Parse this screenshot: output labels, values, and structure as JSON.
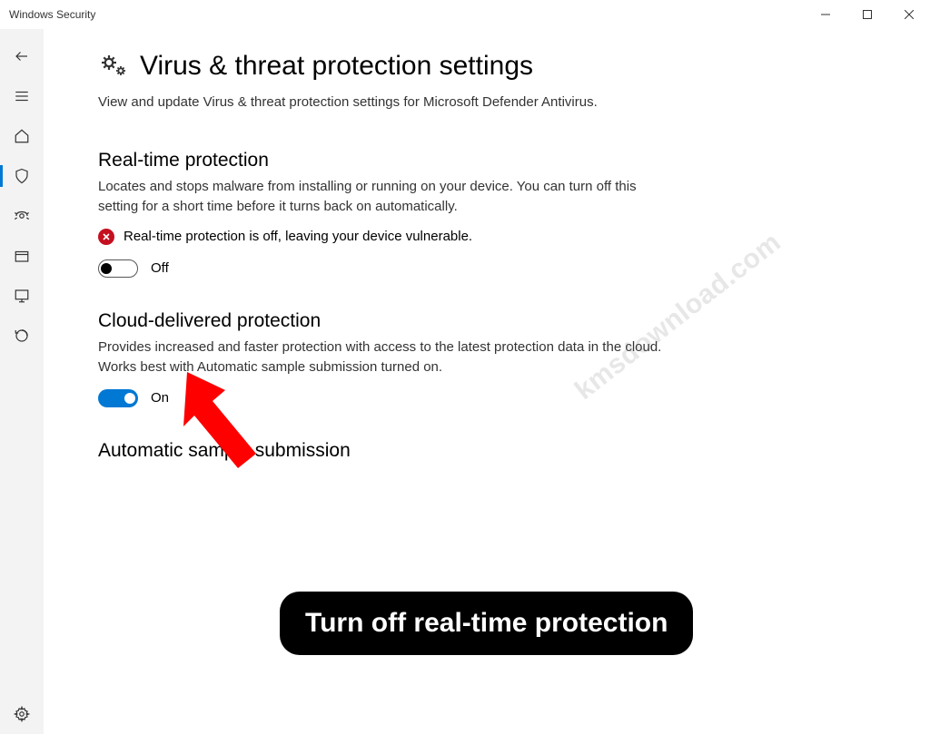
{
  "window": {
    "title": "Windows Security"
  },
  "page": {
    "title": "Virus & threat protection settings",
    "subtitle": "View and update Virus & threat protection settings for Microsoft Defender Antivirus."
  },
  "sections": {
    "realtime": {
      "title": "Real-time protection",
      "desc": "Locates and stops malware from installing or running on your device. You can turn off this setting for a short time before it turns back on automatically.",
      "warning": "Real-time protection is off, leaving your device vulnerable.",
      "toggle_label": "Off",
      "toggle_state": "off"
    },
    "cloud": {
      "title": "Cloud-delivered protection",
      "desc": "Provides increased and faster protection with access to the latest protection data in the cloud. Works best with Automatic sample submission turned on.",
      "toggle_label": "On",
      "toggle_state": "on"
    },
    "auto_sample": {
      "title": "Automatic sample submission"
    }
  },
  "annotation": {
    "caption": "Turn off real-time protection",
    "watermark": "kmsdownload.com"
  }
}
